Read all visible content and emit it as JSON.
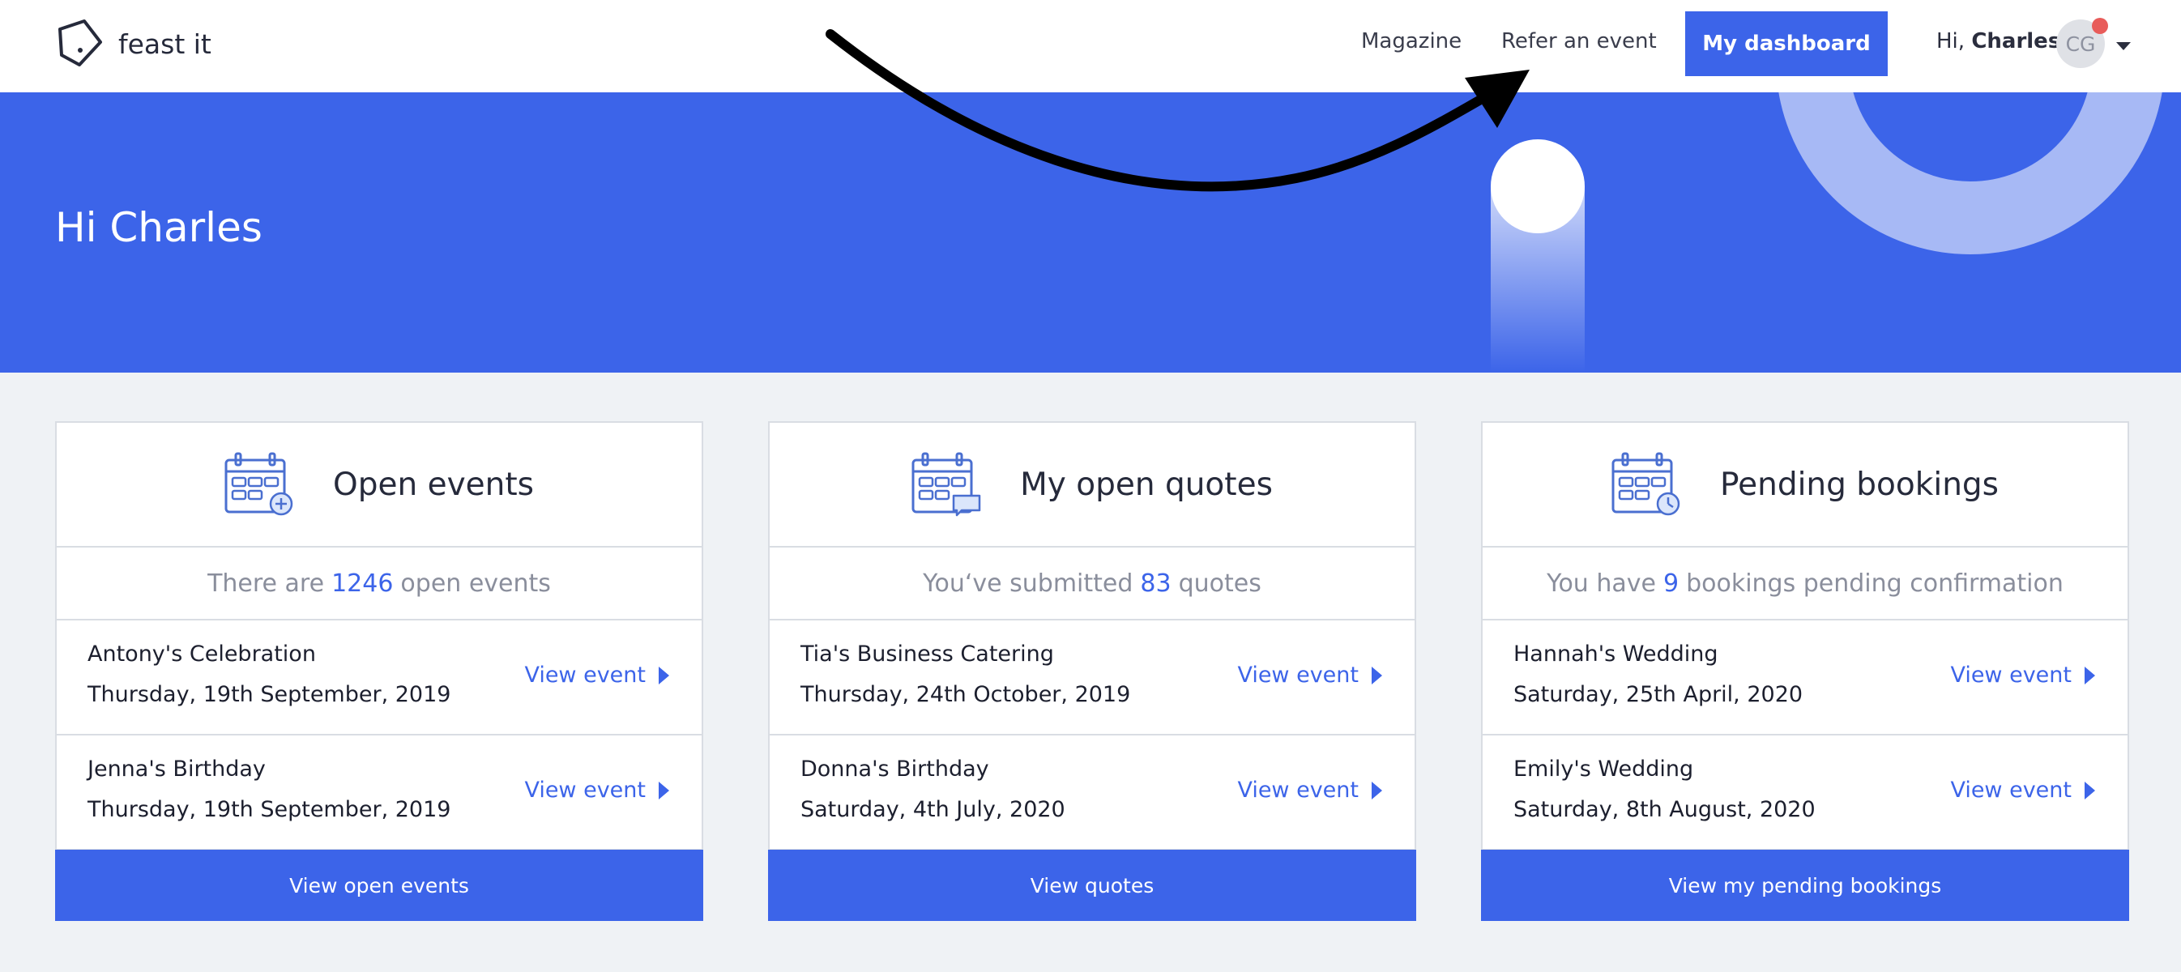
{
  "header": {
    "logo_text": "feast it",
    "nav": {
      "magazine": "Magazine",
      "refer": "Refer an event"
    },
    "dashboard_button": "My dashboard",
    "greeting_prefix": "Hi,",
    "user_name": "Charles",
    "avatar_initials": "CG"
  },
  "hero": {
    "title": "Hi Charles"
  },
  "cards": [
    {
      "title": "Open events",
      "icon": "calendar-plus-icon",
      "summary": {
        "before": "There are",
        "count": "1246",
        "after": "open events"
      },
      "rows": [
        {
          "name": "Antony's Celebration",
          "date": "Thursday, 19th September, 2019",
          "link": "View event"
        },
        {
          "name": "Jenna's Birthday",
          "date": "Thursday, 19th September, 2019",
          "link": "View event"
        }
      ],
      "footer": "View open events"
    },
    {
      "title": "My open quotes",
      "icon": "calendar-chat-icon",
      "summary": {
        "before": "You‘ve submitted",
        "count": "83",
        "after": "quotes"
      },
      "rows": [
        {
          "name": "Tia's Business Catering",
          "date": "Thursday, 24th October, 2019",
          "link": "View event"
        },
        {
          "name": "Donna's Birthday",
          "date": "Saturday, 4th July, 2020",
          "link": "View event"
        }
      ],
      "footer": "View quotes"
    },
    {
      "title": "Pending bookings",
      "icon": "calendar-clock-icon",
      "summary": {
        "before": "You have",
        "count": "9",
        "after": "bookings pending confirmation"
      },
      "rows": [
        {
          "name": "Hannah's Wedding",
          "date": "Saturday, 25th April, 2020",
          "link": "View event"
        },
        {
          "name": "Emily's Wedding",
          "date": "Saturday, 8th August, 2020",
          "link": "View event"
        }
      ],
      "footer": "View my pending bookings"
    }
  ],
  "colors": {
    "brand_blue": "#3c64e9",
    "notification_red": "#e85c5a",
    "background": "#eff2f5"
  }
}
